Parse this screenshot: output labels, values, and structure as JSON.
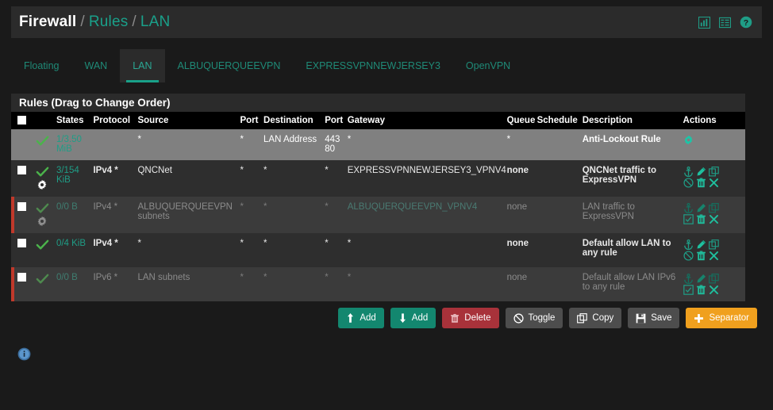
{
  "breadcrumb": {
    "root": "Firewall",
    "sep": "/",
    "crumb1": "Rules",
    "crumb2": "LAN"
  },
  "header_icons": [
    {
      "name": "chart-icon",
      "label": "chart-icon"
    },
    {
      "name": "list-icon",
      "label": "list-icon"
    },
    {
      "name": "help-icon",
      "label": "help-icon"
    }
  ],
  "tabs": [
    {
      "label": "Floating",
      "active": false
    },
    {
      "label": "WAN",
      "active": false
    },
    {
      "label": "LAN",
      "active": true
    },
    {
      "label": "ALBUQUERQUEEVPN",
      "active": false
    },
    {
      "label": "EXPRESSVPNNEWJERSEY3",
      "active": false
    },
    {
      "label": "OpenVPN",
      "active": false
    }
  ],
  "panel": {
    "title": "Rules (Drag to Change Order)",
    "columns": [
      "States",
      "Protocol",
      "Source",
      "Port",
      "Destination",
      "Port",
      "Gateway",
      "Queue",
      "Schedule",
      "Description",
      "Actions"
    ],
    "rows": [
      {
        "states": "1/3.50 MiB",
        "protocol": "",
        "source": "*",
        "port1": "*",
        "destination": "LAN Address",
        "port2": "443 80",
        "gateway": "*",
        "queue": "*",
        "schedule": "",
        "description": "Anti-Lockout Rule",
        "actions": "gear"
      },
      {
        "states": "3/154 KiB",
        "protocol": "IPv4 *",
        "source": "QNCNet",
        "port1": "*",
        "destination": "*",
        "port2": "*",
        "gateway": "EXPRESSVPNNEWJERSEY3_VPNV4",
        "queue": "none",
        "schedule": "",
        "description": "QNCNet traffic to ExpressVPN",
        "actions": "full-disable"
      },
      {
        "states": "0/0 B",
        "protocol": "IPv4 *",
        "source": "ALBUQUERQUEEVPN subnets",
        "port1": "*",
        "destination": "*",
        "port2": "*",
        "gateway": "ALBUQUERQUEEVPN_VPNV4",
        "queue": "none",
        "schedule": "",
        "description": "LAN traffic to ExpressVPN",
        "actions": "full-enable"
      },
      {
        "states": "0/4 KiB",
        "protocol": "IPv4 *",
        "source": "*",
        "port1": "*",
        "destination": "*",
        "port2": "*",
        "gateway": "*",
        "queue": "none",
        "schedule": "",
        "description": "Default allow LAN to any rule",
        "actions": "full-disable"
      },
      {
        "states": "0/0 B",
        "protocol": "IPv6 *",
        "source": "LAN subnets",
        "port1": "*",
        "destination": "*",
        "port2": "*",
        "gateway": "*",
        "queue": "none",
        "schedule": "",
        "description": "Default allow LAN IPv6 to any rule",
        "actions": "full-enable"
      }
    ]
  },
  "buttons": [
    {
      "label": "Add",
      "icon": "arrow-up-icon",
      "style": "green"
    },
    {
      "label": "Add",
      "icon": "arrow-down-icon",
      "style": "green"
    },
    {
      "label": "Delete",
      "icon": "trash-icon",
      "style": "red"
    },
    {
      "label": "Toggle",
      "icon": "ban-icon",
      "style": "gray"
    },
    {
      "label": "Copy",
      "icon": "copy-icon",
      "style": "gray"
    },
    {
      "label": "Save",
      "icon": "save-icon",
      "style": "gray"
    },
    {
      "label": "Separator",
      "icon": "plus-icon",
      "style": "orange"
    }
  ],
  "footer": {
    "info_icon": "info-icon"
  },
  "colors": {
    "accent": "#1f9d86",
    "danger": "#a8323a",
    "warning": "#f0a01e",
    "pass": "#4bb34b",
    "blocked_bar": "#c0392b",
    "info": "#4a87c4"
  }
}
